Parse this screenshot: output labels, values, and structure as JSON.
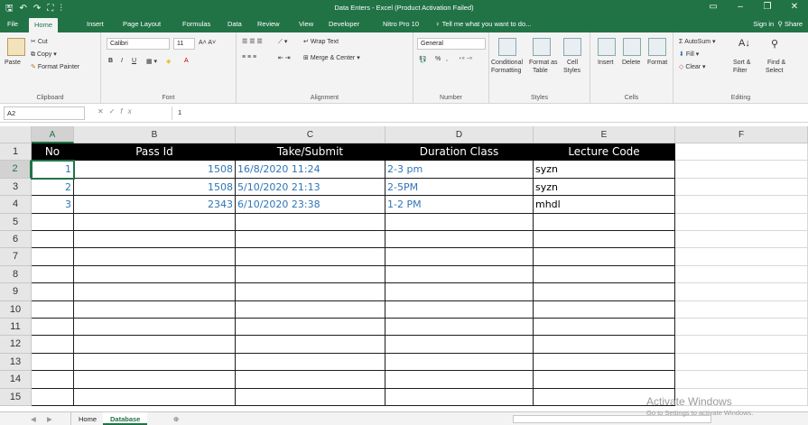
{
  "window": {
    "title": "Data Enters - Excel (Product Activation Failed)",
    "signin": "Sign in",
    "share": "Share"
  },
  "qat": {
    "save": "🖫",
    "undo": "↶",
    "redo": "↷",
    "customize": "⛶",
    "more": "⫶"
  },
  "tabs": [
    "File",
    "Home",
    "Insert",
    "Page Layout",
    "Formulas",
    "Data",
    "Review",
    "View",
    "Developer",
    "Nitro Pro 10"
  ],
  "tell_me": "Tell me what you want to do...",
  "ribbon": {
    "clipboard": {
      "label": "Clipboard",
      "paste": "Paste",
      "cut": "Cut",
      "copy": "Copy",
      "format_painter": "Format Painter"
    },
    "font": {
      "label": "Font",
      "name": "Calibri",
      "size": "11",
      "bold": "B",
      "italic": "I",
      "underline": "U"
    },
    "alignment": {
      "label": "Alignment",
      "wrap_text": "Wrap Text",
      "merge_center": "Merge & Center"
    },
    "number": {
      "label": "Number",
      "format": "General",
      "percent": "%",
      "comma": ","
    },
    "styles": {
      "label": "Styles",
      "conditional": "Conditional",
      "conditional2": "Formatting",
      "format_as": "Format as",
      "format_as2": "Table",
      "cell": "Cell",
      "cell2": "Styles"
    },
    "cells": {
      "label": "Cells",
      "insert": "Insert",
      "delete": "Delete",
      "format": "Format"
    },
    "editing": {
      "label": "Editing",
      "autosum": "AutoSum",
      "fill": "Fill",
      "clear": "Clear",
      "sort": "Sort &",
      "sort2": "Filter",
      "find": "Find &",
      "find2": "Select"
    }
  },
  "formula_bar": {
    "name_box": "A2",
    "fx": "fx",
    "content": "1"
  },
  "columns": [
    "A",
    "B",
    "C",
    "D",
    "E",
    "F"
  ],
  "rows": [
    "1",
    "2",
    "3",
    "4",
    "5",
    "6",
    "7",
    "8",
    "9",
    "10",
    "11",
    "12",
    "13",
    "14",
    "15"
  ],
  "table": {
    "headers": [
      "No",
      "Pass Id",
      "Take/Submit",
      "Duration Class",
      "Lecture Code"
    ],
    "rows": [
      [
        "1",
        "1508",
        "16/8/2020 11:24",
        "2-3 pm",
        "syzn"
      ],
      [
        "2",
        "1508",
        "5/10/2020 21:13",
        "2-5PM",
        "syzn"
      ],
      [
        "3",
        "2343",
        "6/10/2020 23:38",
        "1-2 PM",
        "mhdl"
      ]
    ]
  },
  "sheets": [
    "Home",
    "Database"
  ],
  "active_sheet": "Database",
  "watermark": {
    "line1": "Activate Windows",
    "line2": "Go to Settings to activate Windows."
  },
  "colors": {
    "accent": "#217346",
    "header_bg": "#000000",
    "value_text": "#2e75b6"
  }
}
